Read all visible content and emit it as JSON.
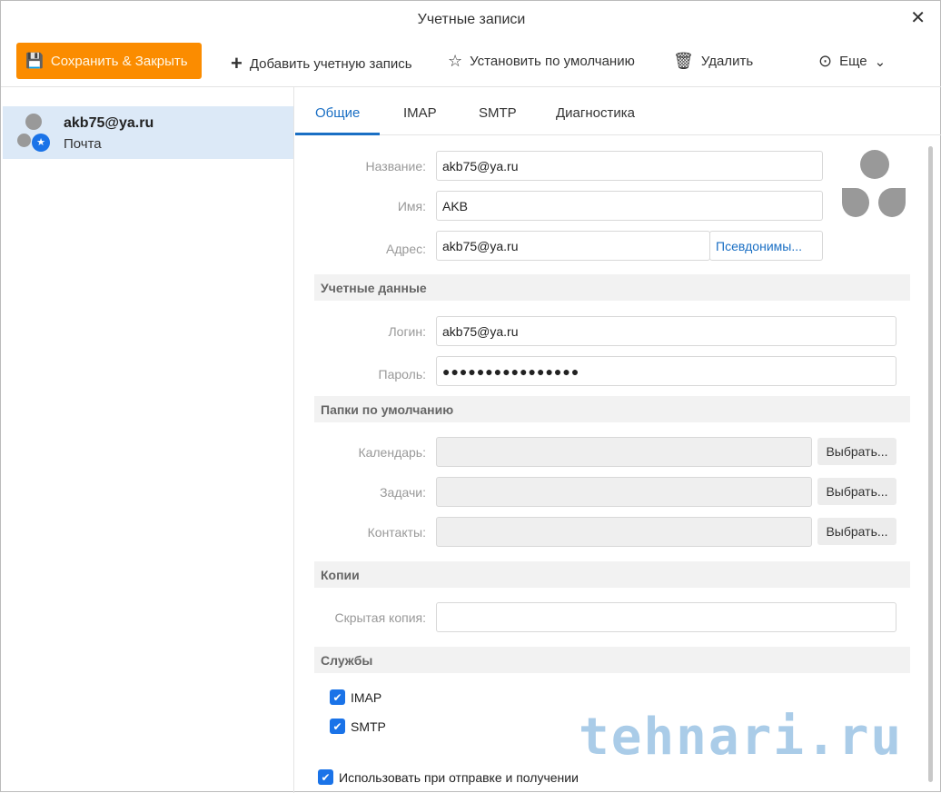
{
  "window": {
    "title": "Учетные записи"
  },
  "toolbar": {
    "save": "Сохранить & Закрыть",
    "add": "Добавить учетную запись",
    "default": "Установить по умолчанию",
    "delete": "Удалить",
    "more": "Еще"
  },
  "account": {
    "email": "akb75@ya.ru",
    "type": "Почта"
  },
  "tabs": [
    "Общие",
    "IMAP",
    "SMTP",
    "Диагностика"
  ],
  "general": {
    "name_label": "Название:",
    "name": "akb75@ya.ru",
    "person_label": "Имя:",
    "person": "AKB",
    "address_label": "Адрес:",
    "address": "akb75@ya.ru",
    "aliases": "Псевдонимы..."
  },
  "credentials": {
    "title": "Учетные данные",
    "login_label": "Логин:",
    "login": "akb75@ya.ru",
    "password_label": "Пароль:",
    "password": "●●●●●●●●●●●●●●●●"
  },
  "folders": {
    "title": "Папки по умолчанию",
    "calendar": "Календарь:",
    "tasks": "Задачи:",
    "contacts": "Контакты:",
    "choose": "Выбрать..."
  },
  "copies": {
    "title": "Копии",
    "bcc_label": "Скрытая копия:",
    "bcc": ""
  },
  "services": {
    "title": "Службы",
    "imap": "IMAP",
    "smtp": "SMTP",
    "use": "Использовать при отправке и получении"
  },
  "watermark": "tehnari.ru"
}
